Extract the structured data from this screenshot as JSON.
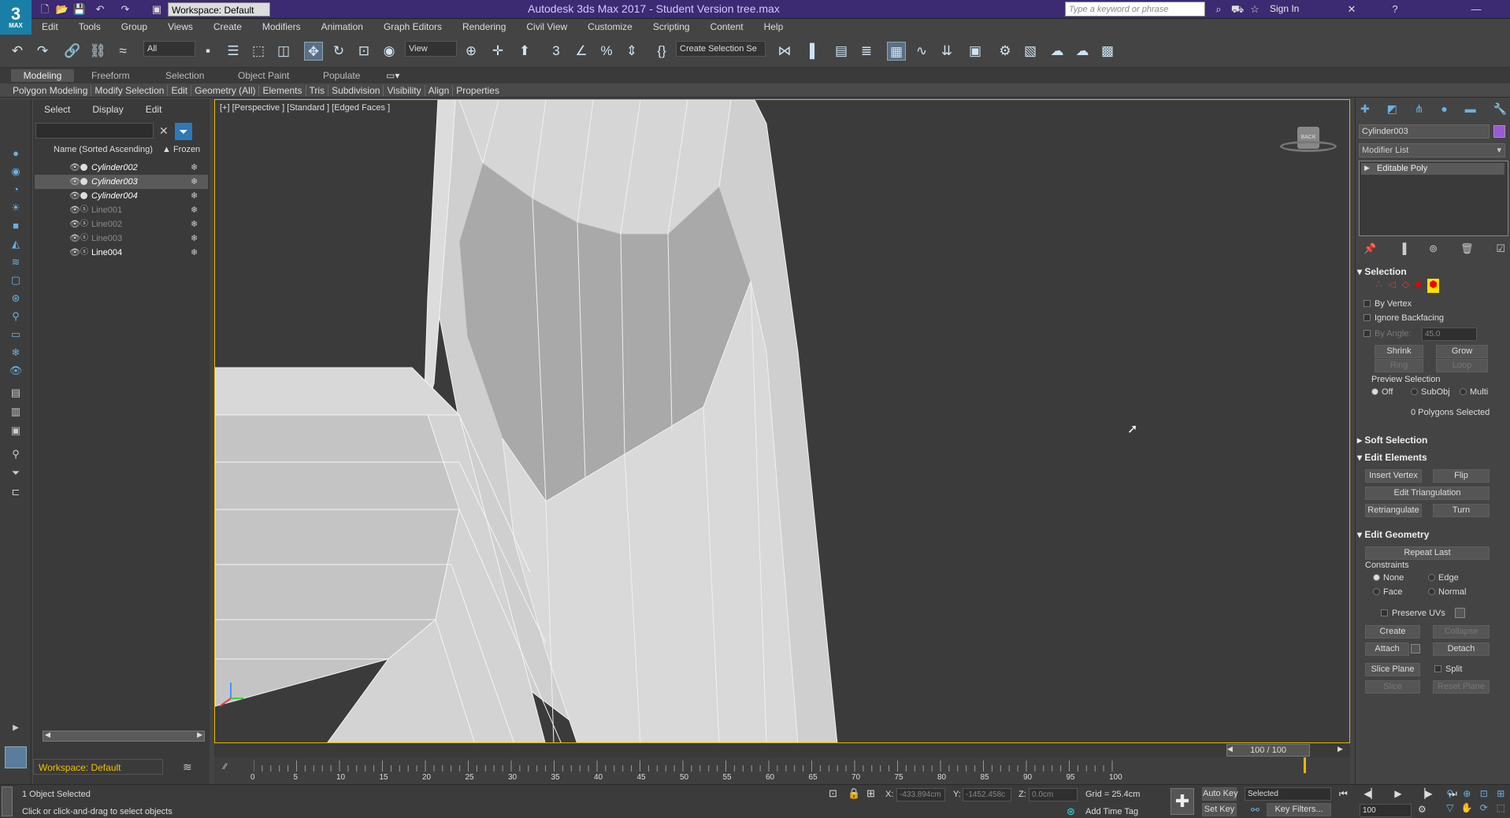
{
  "app": {
    "logo_text": "3",
    "logo_sub": "MAX",
    "title": "Autodesk 3ds Max 2017 - Student Version     tree.max",
    "workspace": "Workspace: Default",
    "search_placeholder": "Type a keyword or phrase",
    "signin": "Sign In"
  },
  "menu": [
    "Edit",
    "Tools",
    "Group",
    "Views",
    "Create",
    "Modifiers",
    "Animation",
    "Graph Editors",
    "Rendering",
    "Civil View",
    "Customize",
    "Scripting",
    "Content",
    "Help"
  ],
  "toolbar": {
    "filter_all": "All",
    "view_combo": "View",
    "selection_set": "Create Selection Se"
  },
  "ribbon": {
    "tabs": [
      "Modeling",
      "Freeform",
      "Selection",
      "Object Paint",
      "Populate"
    ],
    "active_tab": "Modeling",
    "items": [
      "Polygon Modeling",
      "Modify Selection",
      "Edit",
      "Geometry (All)",
      "Elements",
      "Tris",
      "Subdivision",
      "Visibility",
      "Align",
      "Properties"
    ]
  },
  "explorer": {
    "tabs": [
      "Select",
      "Display",
      "Edit"
    ],
    "header_name": "Name (Sorted Ascending)",
    "header_frozen": "▲ Frozen",
    "rows": [
      {
        "name": "Cylinder002",
        "style": "italic",
        "color": "#ffffff",
        "selected": false
      },
      {
        "name": "Cylinder003",
        "style": "italic",
        "color": "#ffffff",
        "selected": true
      },
      {
        "name": "Cylinder004",
        "style": "italic",
        "color": "#ffffff",
        "selected": false
      },
      {
        "name": "Line001",
        "style": "normal",
        "color": "#8a8a8a",
        "selected": false
      },
      {
        "name": "Line002",
        "style": "normal",
        "color": "#8a8a8a",
        "selected": false
      },
      {
        "name": "Line003",
        "style": "normal",
        "color": "#8a8a8a",
        "selected": false
      },
      {
        "name": "Line004",
        "style": "normal",
        "color": "#ffffff",
        "selected": false
      }
    ],
    "workspace": "Workspace: Default"
  },
  "viewport": {
    "label": "[+] [Perspective ] [Standard ] [Edged Faces ]",
    "viewcube_label": "BACK"
  },
  "cmdpanel": {
    "object_name": "Cylinder003",
    "object_color": "#9b59d9",
    "modifier_list": "Modifier List",
    "stack_item": "Editable Poly",
    "selection_title": "Selection",
    "by_vertex": "By Vertex",
    "ignore_backfacing": "Ignore Backfacing",
    "by_angle": "By Angle:",
    "by_angle_value": "45.0",
    "shrink": "Shrink",
    "grow": "Grow",
    "ring": "Ring",
    "loop": "Loop",
    "preview_selection": "Preview Selection",
    "preview_options": [
      "Off",
      "SubObj",
      "Multi"
    ],
    "polys_selected": "0 Polygons Selected",
    "soft_selection": "Soft Selection",
    "edit_elements": "Edit Elements",
    "insert_vertex": "Insert Vertex",
    "flip": "Flip",
    "edit_triangulation": "Edit Triangulation",
    "retriangulate": "Retriangulate",
    "turn": "Turn",
    "edit_geometry": "Edit Geometry",
    "repeat_last": "Repeat Last",
    "constraints": "Constraints",
    "constraint_options": [
      "None",
      "Edge",
      "Face",
      "Normal"
    ],
    "preserve_uvs": "Preserve UVs",
    "create": "Create",
    "collapse": "Collapse",
    "attach": "Attach",
    "detach": "Detach",
    "slice_plane": "Slice Plane",
    "split": "Split",
    "slice": "Slice",
    "reset_plane": "Reset Plane"
  },
  "timeline": {
    "frame": "100 / 100",
    "ticks": [
      "0",
      "5",
      "10",
      "15",
      "20",
      "25",
      "30",
      "35",
      "40",
      "45",
      "50",
      "55",
      "60",
      "65",
      "70",
      "75",
      "80",
      "85",
      "90",
      "95",
      "100"
    ]
  },
  "status": {
    "objects_selected": "1 Object Selected",
    "prompt": "Click or click-and-drag to select objects",
    "x_label": "X:",
    "x_value": "-433.894cm",
    "y_label": "Y:",
    "y_value": "-1452.458c",
    "z_label": "Z:",
    "z_value": "0.0cm",
    "grid": "Grid = 25.4cm",
    "add_time_tag": "Add Time Tag",
    "auto_key": "Auto Key",
    "set_key": "Set Key",
    "key_mode": "Selected",
    "key_filters": "Key Filters...",
    "frame_field": "100"
  }
}
